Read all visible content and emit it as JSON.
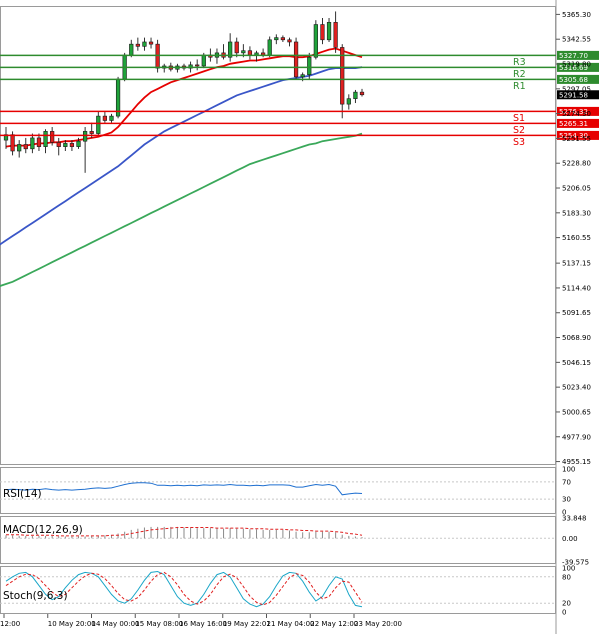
{
  "chart_data": {
    "type": "candlestick",
    "instrument_timeframe": "H4",
    "y_axis_ticks": [
      5365.3,
      5342.55,
      5319.8,
      5297.05,
      5274.3,
      5251.55,
      5228.8,
      5206.05,
      5183.3,
      5160.55,
      5137.15,
      5114.4,
      5091.65,
      5068.9,
      5046.15,
      5023.4,
      5000.65,
      4977.9,
      4955.15
    ],
    "y_axis_labels": [
      "5365.30",
      "5342.55",
      "5319.80",
      "5297.05",
      "5274.30",
      "5251.55",
      "5228.80",
      "5206.05",
      "5183.30",
      "5160.55",
      "5137.15",
      "5114.40",
      "5091.65",
      "5068.90",
      "5046.15",
      "5023.40",
      "5000.65",
      "4977.90",
      "4955.15"
    ],
    "ylim": [
      4952,
      5373
    ],
    "x_tick_labels": [
      "12:00",
      "10 May 20:00",
      "14 May 00:00",
      "15 May 08:00",
      "16 May 16:00",
      "19 May 22:01",
      "21 May 04:00",
      "22 May 12:00",
      "23 May 20:00"
    ],
    "current_price": {
      "value": 5291.58,
      "label": "5291.58"
    },
    "levels": [
      {
        "name": "R3",
        "value": 5327.7,
        "label": "5327.70",
        "color": "#2e8b2e"
      },
      {
        "name": "R2",
        "value": 5316.69,
        "label": "5316.69",
        "color": "#2e8b2e"
      },
      {
        "name": "R1",
        "value": 5305.68,
        "label": "5305.68",
        "color": "#2e8b2e"
      },
      {
        "name": "S1",
        "value": 5276.32,
        "label": "5276.32",
        "color": "#e60000"
      },
      {
        "name": "S2",
        "value": 5265.31,
        "label": "5265.31",
        "color": "#e60000"
      },
      {
        "name": "S3",
        "value": 5254.3,
        "label": "5254.30",
        "color": "#e60000"
      }
    ],
    "candles": [
      {
        "o": 5250,
        "h": 5262,
        "l": 5242,
        "c": 5255
      },
      {
        "o": 5255,
        "h": 5258,
        "l": 5236,
        "c": 5240
      },
      {
        "o": 5240,
        "h": 5250,
        "l": 5234,
        "c": 5246
      },
      {
        "o": 5246,
        "h": 5252,
        "l": 5238,
        "c": 5242
      },
      {
        "o": 5242,
        "h": 5256,
        "l": 5238,
        "c": 5252
      },
      {
        "o": 5252,
        "h": 5256,
        "l": 5240,
        "c": 5244
      },
      {
        "o": 5244,
        "h": 5260,
        "l": 5238,
        "c": 5258
      },
      {
        "o": 5258,
        "h": 5262,
        "l": 5245,
        "c": 5248
      },
      {
        "o": 5248,
        "h": 5252,
        "l": 5236,
        "c": 5244
      },
      {
        "o": 5244,
        "h": 5250,
        "l": 5240,
        "c": 5247
      },
      {
        "o": 5247,
        "h": 5250,
        "l": 5240,
        "c": 5244
      },
      {
        "o": 5244,
        "h": 5252,
        "l": 5242,
        "c": 5249
      },
      {
        "o": 5249,
        "h": 5262,
        "l": 5220,
        "c": 5258
      },
      {
        "o": 5258,
        "h": 5266,
        "l": 5252,
        "c": 5256
      },
      {
        "o": 5256,
        "h": 5276,
        "l": 5254,
        "c": 5272
      },
      {
        "o": 5272,
        "h": 5276,
        "l": 5266,
        "c": 5268
      },
      {
        "o": 5268,
        "h": 5274,
        "l": 5266,
        "c": 5272
      },
      {
        "o": 5272,
        "h": 5308,
        "l": 5270,
        "c": 5306
      },
      {
        "o": 5306,
        "h": 5330,
        "l": 5304,
        "c": 5328
      },
      {
        "o": 5328,
        "h": 5342,
        "l": 5326,
        "c": 5338
      },
      {
        "o": 5338,
        "h": 5344,
        "l": 5332,
        "c": 5336
      },
      {
        "o": 5336,
        "h": 5344,
        "l": 5332,
        "c": 5340
      },
      {
        "o": 5340,
        "h": 5344,
        "l": 5334,
        "c": 5338
      },
      {
        "o": 5338,
        "h": 5342,
        "l": 5312,
        "c": 5316
      },
      {
        "o": 5316,
        "h": 5320,
        "l": 5312,
        "c": 5318
      },
      {
        "o": 5318,
        "h": 5321,
        "l": 5313,
        "c": 5315
      },
      {
        "o": 5315,
        "h": 5320,
        "l": 5312,
        "c": 5318
      },
      {
        "o": 5318,
        "h": 5320,
        "l": 5314,
        "c": 5316
      },
      {
        "o": 5316,
        "h": 5322,
        "l": 5312,
        "c": 5319
      },
      {
        "o": 5319,
        "h": 5324,
        "l": 5314,
        "c": 5318
      },
      {
        "o": 5318,
        "h": 5330,
        "l": 5316,
        "c": 5328
      },
      {
        "o": 5328,
        "h": 5334,
        "l": 5322,
        "c": 5326
      },
      {
        "o": 5326,
        "h": 5334,
        "l": 5320,
        "c": 5330
      },
      {
        "o": 5330,
        "h": 5338,
        "l": 5324,
        "c": 5326
      },
      {
        "o": 5326,
        "h": 5348,
        "l": 5322,
        "c": 5340
      },
      {
        "o": 5340,
        "h": 5344,
        "l": 5326,
        "c": 5330
      },
      {
        "o": 5330,
        "h": 5338,
        "l": 5326,
        "c": 5332
      },
      {
        "o": 5332,
        "h": 5336,
        "l": 5324,
        "c": 5328
      },
      {
        "o": 5328,
        "h": 5332,
        "l": 5322,
        "c": 5330
      },
      {
        "o": 5330,
        "h": 5334,
        "l": 5326,
        "c": 5328
      },
      {
        "o": 5328,
        "h": 5345,
        "l": 5326,
        "c": 5342
      },
      {
        "o": 5342,
        "h": 5347,
        "l": 5338,
        "c": 5344
      },
      {
        "o": 5344,
        "h": 5346,
        "l": 5340,
        "c": 5342
      },
      {
        "o": 5342,
        "h": 5344,
        "l": 5336,
        "c": 5340
      },
      {
        "o": 5340,
        "h": 5344,
        "l": 5306,
        "c": 5308
      },
      {
        "o": 5308,
        "h": 5312,
        "l": 5304,
        "c": 5310
      },
      {
        "o": 5310,
        "h": 5330,
        "l": 5306,
        "c": 5326
      },
      {
        "o": 5326,
        "h": 5360,
        "l": 5324,
        "c": 5356
      },
      {
        "o": 5356,
        "h": 5362,
        "l": 5338,
        "c": 5342
      },
      {
        "o": 5342,
        "h": 5362,
        "l": 5340,
        "c": 5358
      },
      {
        "o": 5358,
        "h": 5368,
        "l": 5330,
        "c": 5335
      },
      {
        "o": 5335,
        "h": 5338,
        "l": 5270,
        "c": 5283
      },
      {
        "o": 5283,
        "h": 5292,
        "l": 5278,
        "c": 5288
      },
      {
        "o": 5288,
        "h": 5296,
        "l": 5284,
        "c": 5294
      },
      {
        "o": 5294,
        "h": 5297,
        "l": 5290,
        "c": 5291.58
      }
    ],
    "series": [
      {
        "name": "",
        "color": "#e60000",
        "values": [
          5244,
          5245,
          5245,
          5245,
          5246,
          5247,
          5247,
          5248,
          5248,
          5249,
          5249,
          5250,
          5251,
          5252,
          5253,
          5255,
          5257,
          5262,
          5269,
          5276,
          5283,
          5289,
          5294,
          5297,
          5300,
          5303,
          5305,
          5307,
          5309,
          5311,
          5313,
          5315,
          5317,
          5318,
          5320,
          5321,
          5322,
          5323,
          5323,
          5324,
          5325,
          5326,
          5327,
          5327,
          5326,
          5326,
          5327,
          5329,
          5331,
          5333,
          5334,
          5332,
          5330,
          5328,
          5326
        ]
      },
      {
        "name": "",
        "color": "#3a56c8",
        "values": [
          5158,
          5162,
          5166,
          5170,
          5174,
          5178,
          5182,
          5186,
          5190,
          5194,
          5198,
          5202,
          5206,
          5210,
          5214,
          5218,
          5222,
          5226,
          5231,
          5236,
          5241,
          5246,
          5250,
          5254,
          5258,
          5261,
          5264,
          5267,
          5270,
          5273,
          5276,
          5279,
          5282,
          5285,
          5288,
          5291,
          5293,
          5295,
          5297,
          5299,
          5301,
          5303,
          5305,
          5306,
          5307,
          5308,
          5309,
          5311,
          5313,
          5315,
          5316,
          5316,
          5316,
          5316,
          5317
        ]
      },
      {
        "name": "",
        "color": "#3aa85a",
        "values": [
          5118,
          5120,
          5123,
          5126,
          5129,
          5132,
          5135,
          5138,
          5141,
          5144,
          5147,
          5150,
          5153,
          5156,
          5159,
          5162,
          5165,
          5168,
          5171,
          5174,
          5177,
          5180,
          5183,
          5186,
          5189,
          5192,
          5195,
          5198,
          5201,
          5204,
          5207,
          5210,
          5213,
          5216,
          5219,
          5222,
          5225,
          5228,
          5230,
          5232,
          5234,
          5236,
          5238,
          5240,
          5242,
          5244,
          5246,
          5247,
          5249,
          5250,
          5251,
          5252,
          5253,
          5254,
          5256
        ]
      }
    ],
    "rsi": {
      "label": "RSI(14)",
      "ticks": [
        "100",
        "70",
        "30",
        "0"
      ],
      "tick_values": [
        100,
        70,
        30,
        0
      ],
      "values": [
        52,
        53,
        52,
        51,
        53,
        52,
        54,
        52,
        51,
        52,
        51,
        52,
        53,
        55,
        56,
        55,
        56,
        60,
        64,
        67,
        68,
        68,
        67,
        62,
        62,
        61,
        62,
        61,
        62,
        61,
        63,
        62,
        63,
        62,
        64,
        62,
        62,
        61,
        62,
        61,
        63,
        63,
        63,
        62,
        58,
        58,
        61,
        64,
        62,
        64,
        60,
        40,
        42,
        44,
        43
      ]
    },
    "macd": {
      "label": "MACD(12,26,9)",
      "ticks": [
        "33.848",
        "0.00",
        "-39.575"
      ],
      "tick_values": [
        33.848,
        0,
        -39.575
      ],
      "hist": [
        5,
        5,
        4,
        4,
        4,
        4,
        4,
        4,
        3,
        3,
        3,
        3,
        3,
        4,
        4,
        5,
        5,
        8,
        11,
        14,
        16,
        18,
        19,
        19,
        19,
        19,
        19,
        18,
        18,
        17,
        17,
        17,
        17,
        16,
        17,
        16,
        16,
        15,
        15,
        14,
        14,
        14,
        14,
        13,
        11,
        10,
        10,
        11,
        11,
        11,
        10,
        6,
        4,
        3,
        2
      ],
      "signal": [
        6,
        6,
        6,
        5,
        5,
        5,
        5,
        5,
        4,
        4,
        4,
        4,
        4,
        4,
        4,
        4,
        5,
        5,
        6,
        8,
        10,
        12,
        14,
        15,
        16,
        17,
        18,
        18,
        18,
        18,
        18,
        18,
        17,
        17,
        17,
        17,
        17,
        16,
        16,
        16,
        15,
        15,
        15,
        14,
        14,
        13,
        13,
        12,
        12,
        12,
        11,
        10,
        8,
        7,
        5
      ]
    },
    "stoch": {
      "label": "Stoch(9,6,3)",
      "ticks": [
        "100",
        "80",
        "20",
        "0"
      ],
      "tick_values": [
        100,
        80,
        20,
        0
      ],
      "k": [
        70,
        80,
        88,
        90,
        80,
        60,
        40,
        28,
        35,
        55,
        72,
        85,
        90,
        88,
        80,
        60,
        40,
        25,
        20,
        30,
        50,
        72,
        90,
        92,
        85,
        60,
        35,
        20,
        15,
        20,
        40,
        65,
        85,
        90,
        80,
        55,
        30,
        18,
        12,
        18,
        35,
        60,
        82,
        90,
        88,
        70,
        45,
        25,
        35,
        60,
        80,
        75,
        40,
        15,
        12
      ],
      "d": [
        60,
        70,
        80,
        86,
        85,
        76,
        60,
        45,
        35,
        40,
        55,
        70,
        82,
        88,
        86,
        76,
        60,
        42,
        28,
        25,
        33,
        50,
        70,
        85,
        90,
        80,
        62,
        40,
        25,
        18,
        25,
        40,
        62,
        80,
        86,
        78,
        58,
        36,
        22,
        16,
        22,
        38,
        58,
        78,
        87,
        83,
        68,
        45,
        30,
        35,
        55,
        70,
        68,
        45,
        22
      ]
    }
  }
}
